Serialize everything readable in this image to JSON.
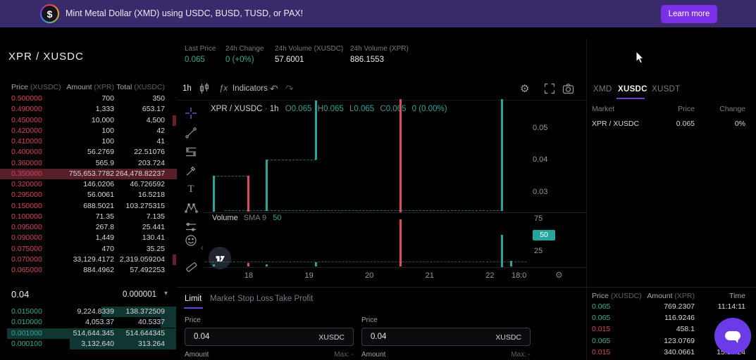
{
  "banner": {
    "text": "Mint Metal Dollar (XMD) using USDC, BUSD, TUSD, or PAX!",
    "button_label": "Learn more",
    "coin_symbol": "$"
  },
  "pair_header": {
    "title": "XPR / XUSDC",
    "stats": [
      {
        "label": "Last Price",
        "value": "0.065",
        "tone": "up"
      },
      {
        "label": "24h Change",
        "value": "0 (+0%)",
        "tone": "up"
      },
      {
        "label": "24h Volume (XUSDC)",
        "value": "57.6001",
        "tone": "plain"
      },
      {
        "label": "24h Volume (XPR)",
        "value": "886.1553",
        "tone": "plain"
      }
    ]
  },
  "order_book": {
    "columns": [
      {
        "label": "Price",
        "unit": "(XUSDC)"
      },
      {
        "label": "Amount",
        "unit": "(XPR)"
      },
      {
        "label": "Total",
        "unit": "(XUSDC)"
      }
    ],
    "sells": [
      {
        "price": "0.500000",
        "amount": "700",
        "total": "350",
        "depth": 0,
        "highlight": false
      },
      {
        "price": "0.490000",
        "amount": "1,333",
        "total": "653.17",
        "depth": 0,
        "highlight": false
      },
      {
        "price": "0.450000",
        "amount": "10,000",
        "total": "4,500",
        "depth": 2,
        "highlight": false
      },
      {
        "price": "0.420000",
        "amount": "100",
        "total": "42",
        "depth": 0,
        "highlight": false
      },
      {
        "price": "0.410000",
        "amount": "100",
        "total": "41",
        "depth": 0,
        "highlight": false
      },
      {
        "price": "0.400000",
        "amount": "56.2769",
        "total": "22.51076",
        "depth": 0,
        "highlight": false
      },
      {
        "price": "0.360000",
        "amount": "565.9",
        "total": "203.724",
        "depth": 0,
        "highlight": false
      },
      {
        "price": "0.350000",
        "amount": "755,653.7782",
        "total": "264,478.82237",
        "depth": 100,
        "highlight": true
      },
      {
        "price": "0.320000",
        "amount": "146.0206",
        "total": "46.726592",
        "depth": 0,
        "highlight": false
      },
      {
        "price": "0.295000",
        "amount": "56.0061",
        "total": "16.5218",
        "depth": 0,
        "highlight": false
      },
      {
        "price": "0.150000",
        "amount": "688.5021",
        "total": "103.275315",
        "depth": 0,
        "highlight": false
      },
      {
        "price": "0.100000",
        "amount": "71.35",
        "total": "7.135",
        "depth": 0,
        "highlight": false
      },
      {
        "price": "0.095000",
        "amount": "267.8",
        "total": "25.441",
        "depth": 0,
        "highlight": false
      },
      {
        "price": "0.090000",
        "amount": "1,449",
        "total": "130.41",
        "depth": 0,
        "highlight": false
      },
      {
        "price": "0.075000",
        "amount": "470",
        "total": "35.25",
        "depth": 0,
        "highlight": false
      },
      {
        "price": "0.070000",
        "amount": "33,129.4172",
        "total": "2,319.059204",
        "depth": 2,
        "highlight": false
      },
      {
        "price": "0.065000",
        "amount": "884.4962",
        "total": "57.492253",
        "depth": 0,
        "highlight": false
      }
    ],
    "mid": {
      "last_price": "0.04",
      "tick_size": "0.000001"
    },
    "buys": [
      {
        "price": "0.015000",
        "amount": "9,224.8339",
        "total": "138.372509",
        "depth": 44,
        "highlight": false
      },
      {
        "price": "0.010000",
        "amount": "4,053.37",
        "total": "40.5337",
        "depth": 9,
        "highlight": false
      },
      {
        "price": "0.001000",
        "amount": "514,644.345",
        "total": "514.644345",
        "depth": 100,
        "highlight": false
      },
      {
        "price": "0.000100",
        "amount": "3,132,640",
        "total": "313.264",
        "depth": 63,
        "highlight": false
      }
    ]
  },
  "chart": {
    "toolbar": {
      "interval": "1h",
      "indicators_label": "Indicators"
    },
    "legend": {
      "pair": "XPR / XUSDC",
      "sep": "·",
      "interval": "1h",
      "o_label": "O",
      "o": "0.065",
      "h_label": "H",
      "h": "0.065",
      "l_label": "L",
      "l": "0.065",
      "c_label": "C",
      "c": "0.065",
      "change": "0 (0.00%)"
    },
    "volume_legend": {
      "label": "Volume",
      "sma": "SMA 9",
      "value": "50"
    },
    "time_current": "18:0",
    "chart_data": {
      "type": "bar",
      "pair": "XPR/XUSDC",
      "interval": "1h",
      "price_ticks": [
        0.05,
        0.04,
        0.03
      ],
      "volume_ticks": [
        75,
        25
      ],
      "volume_badge": 50,
      "time_ticks": [
        18,
        19,
        20,
        21,
        22
      ],
      "candles": [
        {
          "hour": 17.42,
          "dir": "up",
          "high": 0.035,
          "low": 0.0237
        },
        {
          "hour": 17.99,
          "dir": "down",
          "high": 0.035,
          "low": 0.0237
        },
        {
          "hour": 18.3,
          "dir": "up",
          "high": 0.04,
          "low": 0.024
        },
        {
          "hour": 19.12,
          "dir": "up",
          "high": 0.0585,
          "low": 0.04
        },
        {
          "hour": 20.52,
          "dir": "down",
          "high": 0.0588,
          "low": 0.0235
        },
        {
          "hour": 22.2,
          "dir": "up",
          "high": 0.0588,
          "low": 0.0239
        }
      ],
      "connectors": [
        {
          "from": 17.42,
          "to": 17.99,
          "price": 0.035,
          "dir": "up"
        },
        {
          "from": 18.3,
          "to": 19.12,
          "price": 0.04,
          "dir": "up"
        },
        {
          "from": 17.6,
          "to": 22.2,
          "price": 0.0241,
          "dir": "up"
        }
      ],
      "volumes": [
        {
          "hour": 17.42,
          "dir": "up",
          "value": 4
        },
        {
          "hour": 17.99,
          "dir": "down",
          "value": 6
        },
        {
          "hour": 18.3,
          "dir": "up",
          "value": 4
        },
        {
          "hour": 19.12,
          "dir": "up",
          "value": 7
        },
        {
          "hour": 20.52,
          "dir": "down",
          "value": 74
        },
        {
          "hour": 22.2,
          "dir": "up",
          "value": 50
        },
        {
          "hour": 22.35,
          "dir": "up",
          "value": 9
        }
      ],
      "volume_sma_value": 8
    }
  },
  "markets_panel": {
    "tabs": [
      "XMD",
      "XUSDC",
      "XUSDT"
    ],
    "active_tab": "XUSDC",
    "columns": [
      "Market",
      "Price",
      "Change"
    ],
    "rows": [
      {
        "market": "XPR / XUSDC",
        "price": "0.065",
        "change": "0%"
      }
    ]
  },
  "order_form": {
    "tabs": [
      "Limit",
      "Market",
      "Stop Loss",
      "Take Profit"
    ],
    "active_tab": "Limit",
    "sides": [
      {
        "price_label": "Price",
        "price_value": "0.04",
        "price_unit": "XUSDC",
        "amount_label": "Amount",
        "max_label": "Max: -"
      },
      {
        "price_label": "Price",
        "price_value": "0.04",
        "price_unit": "XUSDC",
        "amount_label": "Amount",
        "max_label": "Max: -"
      }
    ]
  },
  "trades_panel": {
    "columns": [
      {
        "label": "Price",
        "unit": "(XUSDC)"
      },
      {
        "label": "Amount",
        "unit": "(XPR)"
      },
      {
        "label": "Time",
        "unit": ""
      }
    ],
    "rows": [
      {
        "price": "0.065",
        "side": "buy",
        "amount": "769.2307",
        "time": "11:14:11"
      },
      {
        "price": "0.065",
        "side": "buy",
        "amount": "116.9246",
        "time": ""
      },
      {
        "price": "0.015",
        "side": "sell",
        "amount": "458.1",
        "time": ""
      },
      {
        "price": "0.065",
        "side": "buy",
        "amount": "123.0769",
        "time": ""
      },
      {
        "price": "0.015",
        "side": "sell",
        "amount": "340.0661",
        "time": "15:33:24"
      }
    ]
  },
  "icons": {
    "fx": "ƒx",
    "undo": "↶",
    "redo": "↷",
    "gear": "⚙",
    "caret_down": "▾",
    "collapse": "‹"
  },
  "colors": {
    "accent": "#7c3aed",
    "banner_bg": "#392a6b",
    "up": "#26a69a",
    "down": "#d8415c"
  }
}
